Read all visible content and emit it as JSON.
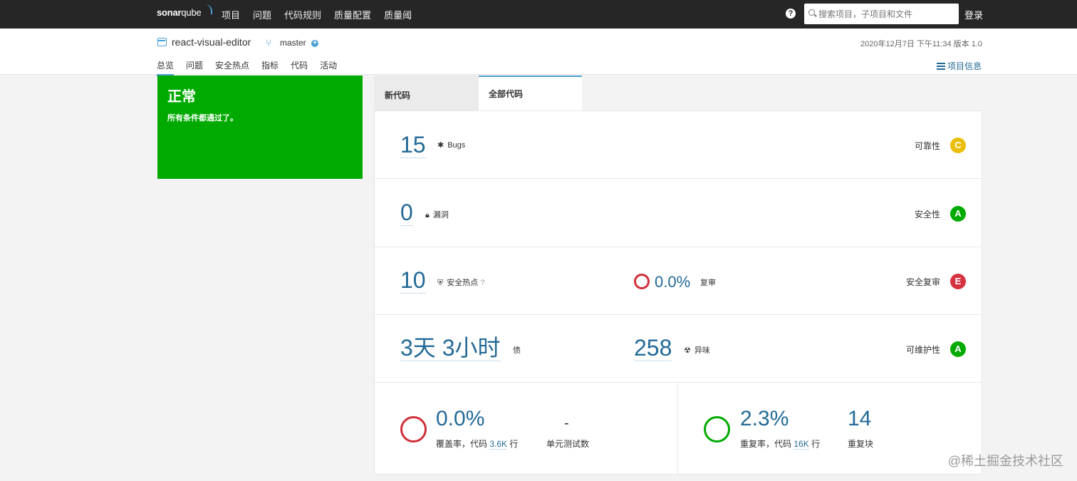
{
  "topbar": {
    "logo_main": "sonar",
    "logo_sub": "qube",
    "nav": [
      "项目",
      "问题",
      "代码规则",
      "质量配置",
      "质量阈"
    ],
    "help_icon": "?",
    "search_placeholder": "搜索项目，子项目和文件",
    "login": "登录"
  },
  "project": {
    "name": "react-visual-editor",
    "branch": "master",
    "branch_add": "+",
    "meta": "2020年12月7日 下午11:34  版本 1.0",
    "tabs": [
      "总览",
      "问题",
      "安全热点",
      "指标",
      "代码",
      "活动"
    ],
    "info": "项目信息"
  },
  "gate": {
    "status": "正常",
    "description": "所有条件都通过了。"
  },
  "tabs": {
    "new_code": "新代码",
    "all_code": "全部代码"
  },
  "measures": {
    "bugs": {
      "value": "15",
      "label": "Bugs",
      "rating_label": "可靠性",
      "rating": "C"
    },
    "vulnerabilities": {
      "value": "0",
      "label": "漏洞",
      "rating_label": "安全性",
      "rating": "A"
    },
    "hotspots": {
      "value": "10",
      "label": "安全热点",
      "help": "?",
      "reviewed_value": "0.0%",
      "reviewed_label": "复审",
      "rating_label": "安全复审",
      "rating": "E"
    },
    "debt": {
      "value": "3天 3小时",
      "label": "债",
      "smells_value": "258",
      "smells_label": "异味",
      "rating_label": "可维护性",
      "rating": "A"
    },
    "coverage": {
      "value": "0.0%",
      "label_prefix": "覆盖率，代码",
      "lines": "3.6K",
      "label_suffix": "行",
      "tests_value": "-",
      "tests_label": "单元测试数"
    },
    "duplications": {
      "value": "2.3%",
      "label_prefix": "重复率，代码",
      "lines": "16K",
      "label_suffix": "行",
      "blocks_value": "14",
      "blocks_label": "重复块"
    }
  },
  "colors": {
    "accent": "#4b9fd5",
    "link": "#236a97",
    "passed": "#00aa00",
    "rating_c": "#eabe06",
    "rating_e": "#d4333f",
    "coverage_ring": "#d02f3a",
    "duplication_ring": "#00aa00"
  },
  "watermark": "@稀土掘金技术社区"
}
